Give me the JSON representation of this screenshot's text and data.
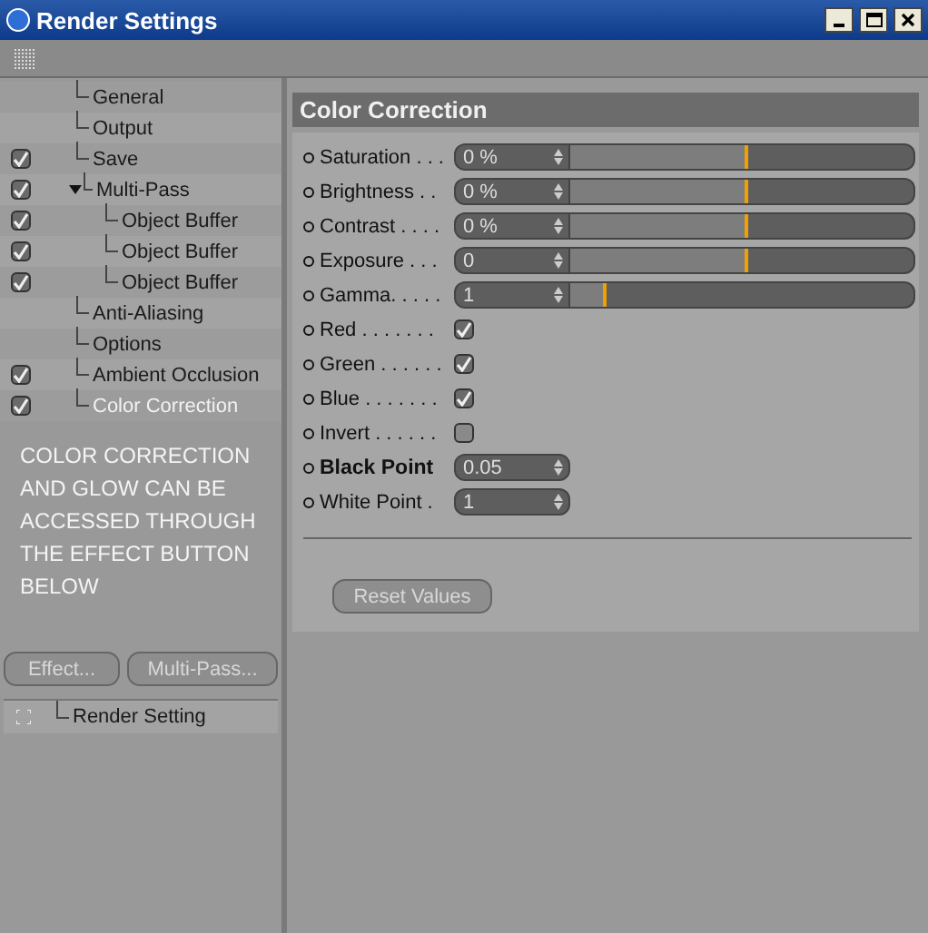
{
  "window": {
    "title": "Render Settings"
  },
  "tree": [
    {
      "label": "General",
      "enabled": false,
      "selected": false
    },
    {
      "label": "Output",
      "enabled": false,
      "selected": false
    },
    {
      "label": "Save",
      "enabled": true,
      "selected": false
    },
    {
      "label": "Multi-Pass",
      "enabled": true,
      "selected": false,
      "expanded": true,
      "children": [
        {
          "label": "Object Buffer",
          "enabled": true,
          "selected": false
        },
        {
          "label": "Object Buffer",
          "enabled": true,
          "selected": false
        },
        {
          "label": "Object Buffer",
          "enabled": true,
          "selected": false
        }
      ]
    },
    {
      "label": "Anti-Aliasing",
      "enabled": false,
      "selected": false
    },
    {
      "label": "Options",
      "enabled": false,
      "selected": false
    },
    {
      "label": "Ambient Occlusion",
      "enabled": true,
      "selected": false
    },
    {
      "label": "Color Correction",
      "enabled": true,
      "selected": true
    }
  ],
  "note": "COLOR CORRECTION AND GLOW CAN BE ACCESSED THROUGH THE EFFECT BUTTON BELOW",
  "left_buttons": [
    "Effect...",
    "Multi-Pass..."
  ],
  "settings_list": [
    {
      "label": "Render Setting"
    }
  ],
  "panel": {
    "title": "Color Correction",
    "params": [
      {
        "kind": "slider",
        "label": "Saturation . . .",
        "value": "0 %",
        "level": 0.51,
        "bold": false
      },
      {
        "kind": "slider",
        "label": "Brightness . .",
        "value": "0 %",
        "level": 0.51,
        "bold": false
      },
      {
        "kind": "slider",
        "label": "Contrast . . . .",
        "value": "0 %",
        "level": 0.51,
        "bold": false
      },
      {
        "kind": "slider",
        "label": "Exposure . . .",
        "value": "0",
        "level": 0.51,
        "bold": false
      },
      {
        "kind": "slider",
        "label": "Gamma. . . . .",
        "value": "1",
        "level": 0.095,
        "bold": false
      },
      {
        "kind": "checkbox",
        "label": "Red . . . . . . .",
        "checked": true,
        "bold": false
      },
      {
        "kind": "checkbox",
        "label": "Green . . . . . .",
        "checked": true,
        "bold": false
      },
      {
        "kind": "checkbox",
        "label": "Blue . . . . . . .",
        "checked": true,
        "bold": false
      },
      {
        "kind": "checkbox",
        "label": "Invert . . . . . .",
        "checked": false,
        "bold": false
      },
      {
        "kind": "number",
        "label": "Black Point",
        "value": "0.05",
        "bold": true
      },
      {
        "kind": "number",
        "label": "White Point .",
        "value": "1",
        "bold": false
      }
    ],
    "button": "Reset Values"
  }
}
